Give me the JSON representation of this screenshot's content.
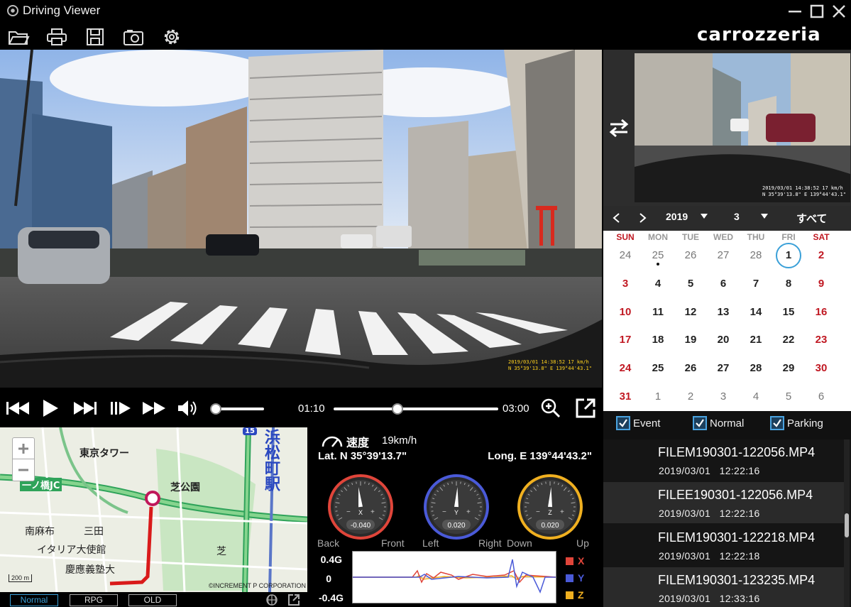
{
  "window": {
    "title": "Driving Viewer"
  },
  "brand": "carrozzeria",
  "video": {
    "stamp_line1": "2019/03/01 14:38:52 17 km/h",
    "stamp_line2": "N 35°39'13.8\" E 139°44'43.1\""
  },
  "sub_video": {
    "stamp_line1": "2019/03/01 14:38:52 17 km/h",
    "stamp_line2": "N 35°39'13.8\" E 139°44'43.1\""
  },
  "player": {
    "current_time": "01:10",
    "total_time": "03:00",
    "progress_fraction": 0.39,
    "volume_fraction": 0.05
  },
  "map": {
    "labels": {
      "tokyo_tower": "東京タワー",
      "shibakoen": "芝公園",
      "ichinohashi": "一ノ橋JC",
      "minamiazabu": "南麻布",
      "mita": "三田",
      "italy": "イタリア大使館",
      "keio": "慶應義塾大",
      "hamamatsucho": "浜松町駅",
      "shiba": "芝",
      "highway_num": "15"
    },
    "scale": "200 m",
    "copyright": "©INCREMENT P CORPORATION",
    "tabs": [
      "Normal",
      "RPG",
      "OLD"
    ]
  },
  "sensor": {
    "speed_label": "速度",
    "speed_value": "19km/h",
    "lat": "Lat. N 35°39'13.7\"",
    "long": "Long. E 139°44'43.2\"",
    "gauges": [
      {
        "axis": "X",
        "value": "-0.040",
        "color": "#e0453a",
        "neg_label": "Back",
        "pos_label": "Front"
      },
      {
        "axis": "Y",
        "value": "0.020",
        "color": "#4a5ad8",
        "neg_label": "Left",
        "pos_label": "Right"
      },
      {
        "axis": "Z",
        "value": "0.020",
        "color": "#f0b020",
        "neg_label": "Down",
        "pos_label": "Up"
      }
    ],
    "gauge_minus": "−",
    "gauge_plus": "+",
    "graph_labels": [
      "0.4G",
      "0",
      "-0.4G"
    ],
    "legend": [
      {
        "name": "X",
        "color": "#e0453a"
      },
      {
        "name": "Y",
        "color": "#4a5ad8"
      },
      {
        "name": "Z",
        "color": "#f0b020"
      }
    ]
  },
  "calendar": {
    "year": "2019",
    "month": "3",
    "all_label": "すべて",
    "weekdays": [
      "SUN",
      "MON",
      "TUE",
      "WED",
      "THU",
      "FRI",
      "SAT"
    ],
    "weeks": [
      [
        "24",
        "25",
        "26",
        "27",
        "28",
        "1",
        "2"
      ],
      [
        "3",
        "4",
        "5",
        "6",
        "7",
        "8",
        "9"
      ],
      [
        "10",
        "11",
        "12",
        "13",
        "14",
        "15",
        "16"
      ],
      [
        "17",
        "18",
        "19",
        "20",
        "21",
        "22",
        "23"
      ],
      [
        "24",
        "25",
        "26",
        "27",
        "28",
        "29",
        "30"
      ],
      [
        "31",
        "1",
        "2",
        "3",
        "4",
        "5",
        "6"
      ]
    ],
    "selected_day": "1",
    "sunday_color": "#c01822",
    "saturday_color": "#c01822",
    "selection_color": "#3aa0d8"
  },
  "filters": [
    {
      "label": "Event",
      "checked": true
    },
    {
      "label": "Normal",
      "checked": true
    },
    {
      "label": "Parking",
      "checked": true
    }
  ],
  "files": [
    {
      "name": "FILEM190301-122056.MP4",
      "date": "2019/03/01",
      "time": "12:22:16"
    },
    {
      "name": "FILEE190301-122056.MP4",
      "date": "2019/03/01",
      "time": "12:22:16"
    },
    {
      "name": "FILEM190301-122218.MP4",
      "date": "2019/03/01",
      "time": "12:22:18"
    },
    {
      "name": "FILEM190301-123235.MP4",
      "date": "2019/03/01",
      "time": "12:33:16"
    }
  ]
}
